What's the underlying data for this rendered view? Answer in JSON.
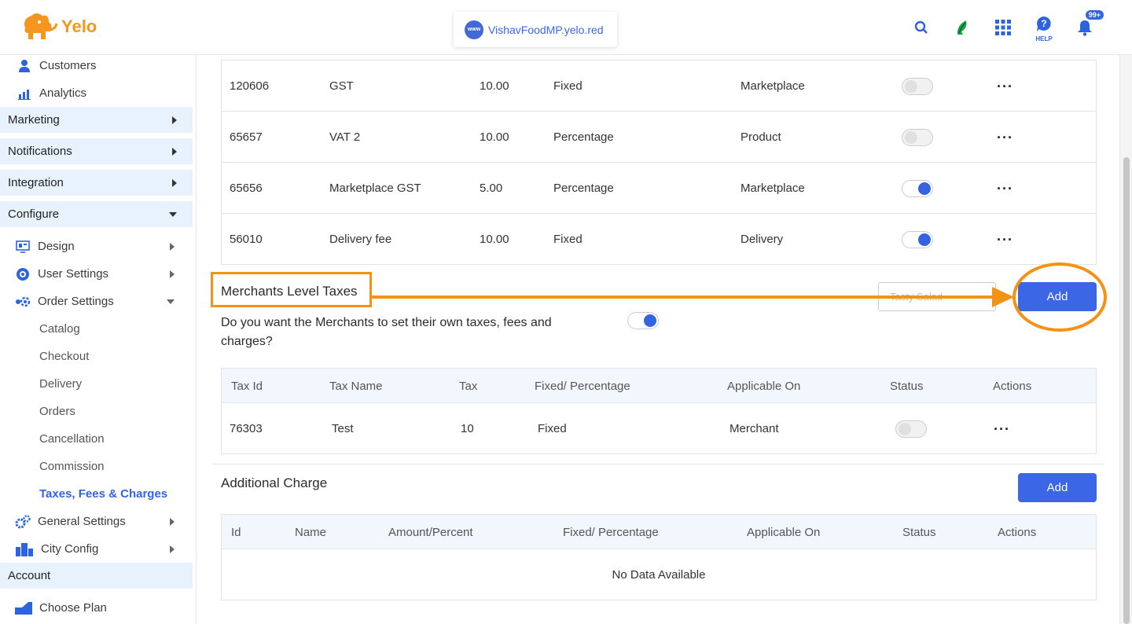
{
  "app": {
    "logo_text": "Yelo",
    "domain": "VishavFoodMP.yelo.red",
    "help_label": "HELP",
    "notification_count": "99+",
    "accent_color": "#3b67e6",
    "annotation_color": "#f39214"
  },
  "sidebar": {
    "top_items": [
      {
        "label": "Customers",
        "icon": "customer-icon"
      },
      {
        "label": "Analytics",
        "icon": "analytics-icon"
      }
    ],
    "sections": {
      "marketing": "Marketing",
      "notifications": "Notifications",
      "integration": "Integration",
      "configure": "Configure",
      "account": "Account"
    },
    "configure_items": {
      "design": "Design",
      "user_settings": "User Settings",
      "order_settings": "Order Settings",
      "general_settings": "General Settings",
      "city_config": "City Config"
    },
    "order_sub_items": [
      "Catalog",
      "Checkout",
      "Delivery",
      "Orders",
      "Cancellation",
      "Commission",
      "Taxes, Fees & Charges"
    ],
    "active_sub_item": "Taxes, Fees & Charges",
    "account_items": {
      "choose_plan": "Choose Plan"
    }
  },
  "marketplace_taxes": {
    "rows": [
      {
        "id": "120606",
        "name": "GST",
        "tax": "10.00",
        "type": "Fixed",
        "applicable": "Marketplace",
        "status": false
      },
      {
        "id": "65657",
        "name": "VAT 2",
        "tax": "10.00",
        "type": "Percentage",
        "applicable": "Product",
        "status": false
      },
      {
        "id": "65656",
        "name": "Marketplace GST",
        "tax": "5.00",
        "type": "Percentage",
        "applicable": "Marketplace",
        "status": true
      },
      {
        "id": "56010",
        "name": "Delivery fee",
        "tax": "10.00",
        "type": "Fixed",
        "applicable": "Delivery",
        "status": true
      }
    ]
  },
  "merchant_taxes": {
    "title": "Merchants Level Taxes",
    "select_placeholder": "Tasty Salad",
    "add_label": "Add",
    "question": "Do you want the Merchants to set their own taxes, fees and charges?",
    "question_toggle": true,
    "headers": {
      "id": "Tax Id",
      "name": "Tax Name",
      "tax": "Tax",
      "type": "Fixed/ Percentage",
      "applicable": "Applicable On",
      "status": "Status",
      "actions": "Actions"
    },
    "rows": [
      {
        "id": "76303",
        "name": "Test",
        "tax": "10",
        "type": "Fixed",
        "applicable": "Merchant",
        "status": false
      }
    ]
  },
  "additional_charge": {
    "title": "Additional Charge",
    "add_label": "Add",
    "headers": {
      "id": "Id",
      "name": "Name",
      "amount": "Amount/Percent",
      "type": "Fixed/ Percentage",
      "applicable": "Applicable On",
      "status": "Status",
      "actions": "Actions"
    },
    "empty_text": "No Data Available"
  }
}
